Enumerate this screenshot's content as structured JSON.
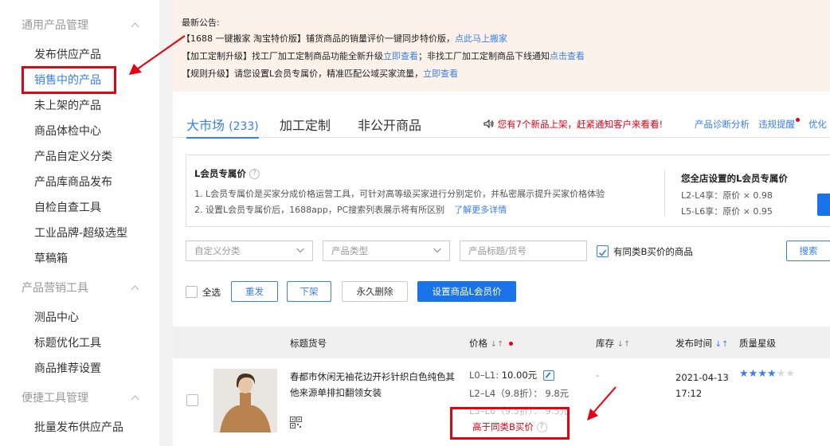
{
  "sidebar": {
    "group1": {
      "label": "通用产品管理"
    },
    "group1_items": [
      "发布供应产品",
      "销售中的产品",
      "未上架的产品",
      "商品体检中心",
      "产品自定义分类",
      "产品库商品发布",
      "自检自查工具",
      "工业品牌-超级选型",
      "草稿箱"
    ],
    "group2": {
      "label": "产品营销工具"
    },
    "group2_items": [
      "测品中心",
      "标题优化工具",
      "商品推荐设置"
    ],
    "group3": {
      "label": "便捷工具管理"
    },
    "group3_items": [
      "批量发布供应产品"
    ]
  },
  "notice": {
    "title": "最新公告:",
    "line1_text": "【1688 一键搬家 淘宝特价版】铺货商品的销量评价一键同步特价版，",
    "line1_link": "点此马上搬家",
    "line2_text": "【加工定制升级】找工厂加工定制商品功能全新升级",
    "line2_link1": "立即查看",
    "line2_mid": "；非找工厂加工定制商品下线通知",
    "line2_link2": "点击查看",
    "line3_text": "【规则升级】请您设置L会员专属价，精准匹配公域买家流量，",
    "line3_link": "立即查看"
  },
  "tabs": {
    "market": "大市场",
    "market_count": "(233)",
    "custom": "加工定制",
    "private": "非公开商品",
    "speaker_text": "您有7个新品上架，赶紧通知客户来看看!",
    "link_diag": "产品诊断分析",
    "link_violation": "违规提醒",
    "link_opt": "优化"
  },
  "lbox": {
    "title": "L会员专属价",
    "help": "?",
    "line1": "1. L会员专属价是买家分成价格运营工具，可针对高等级买家进行分别定价，并私密展示提升买家价格体验",
    "line2": "2. 设置L会员专属价后，1688app，PC搜索列表展示将有所区别",
    "more_link": "了解更多详情",
    "right_title": "您全店设置的L会员专属价",
    "right_l2l4": "L2-L4享：原价 × 0.98",
    "right_l5l6": "L5-L6享：原价 × 0.95"
  },
  "filters": {
    "custom_category": "自定义分类",
    "product_type": "产品类型",
    "title_placeholder": "产品标题/货号",
    "same_b_label": "有同类B买价的商品",
    "search_btn": "搜索"
  },
  "actions": {
    "select_all": "全选",
    "republish": "重发",
    "offline": "下架",
    "delete": "永久删除",
    "set_l_price": "设置商品L会员价"
  },
  "table": {
    "col_title": "标题货号",
    "col_price": "价格",
    "col_stock": "库存",
    "col_time": "发布时间",
    "col_quality": "质量星级",
    "rows": [
      {
        "title": "春都市休闲无袖花边开衫针织白色纯色其他来源单排扣翻领女装",
        "price_l0l1_label": "L0–L1:",
        "price_l0l1_value": "10.00元",
        "price_l2l4": "L2–L4（9.8折）：  9.8元",
        "price_l5l6": "L5–L6（9.5折）：  9.5元",
        "stock": "-",
        "publish_time": "2021-04-13 17:12",
        "stars": 4,
        "stars_total": 6,
        "warning": "高于同类B买价"
      }
    ]
  },
  "colors": {
    "accent": "#3a7ee8",
    "primary_button": "#1a73e8",
    "alert_red": "#e60012",
    "notice_bg": "#fdf2e9"
  }
}
